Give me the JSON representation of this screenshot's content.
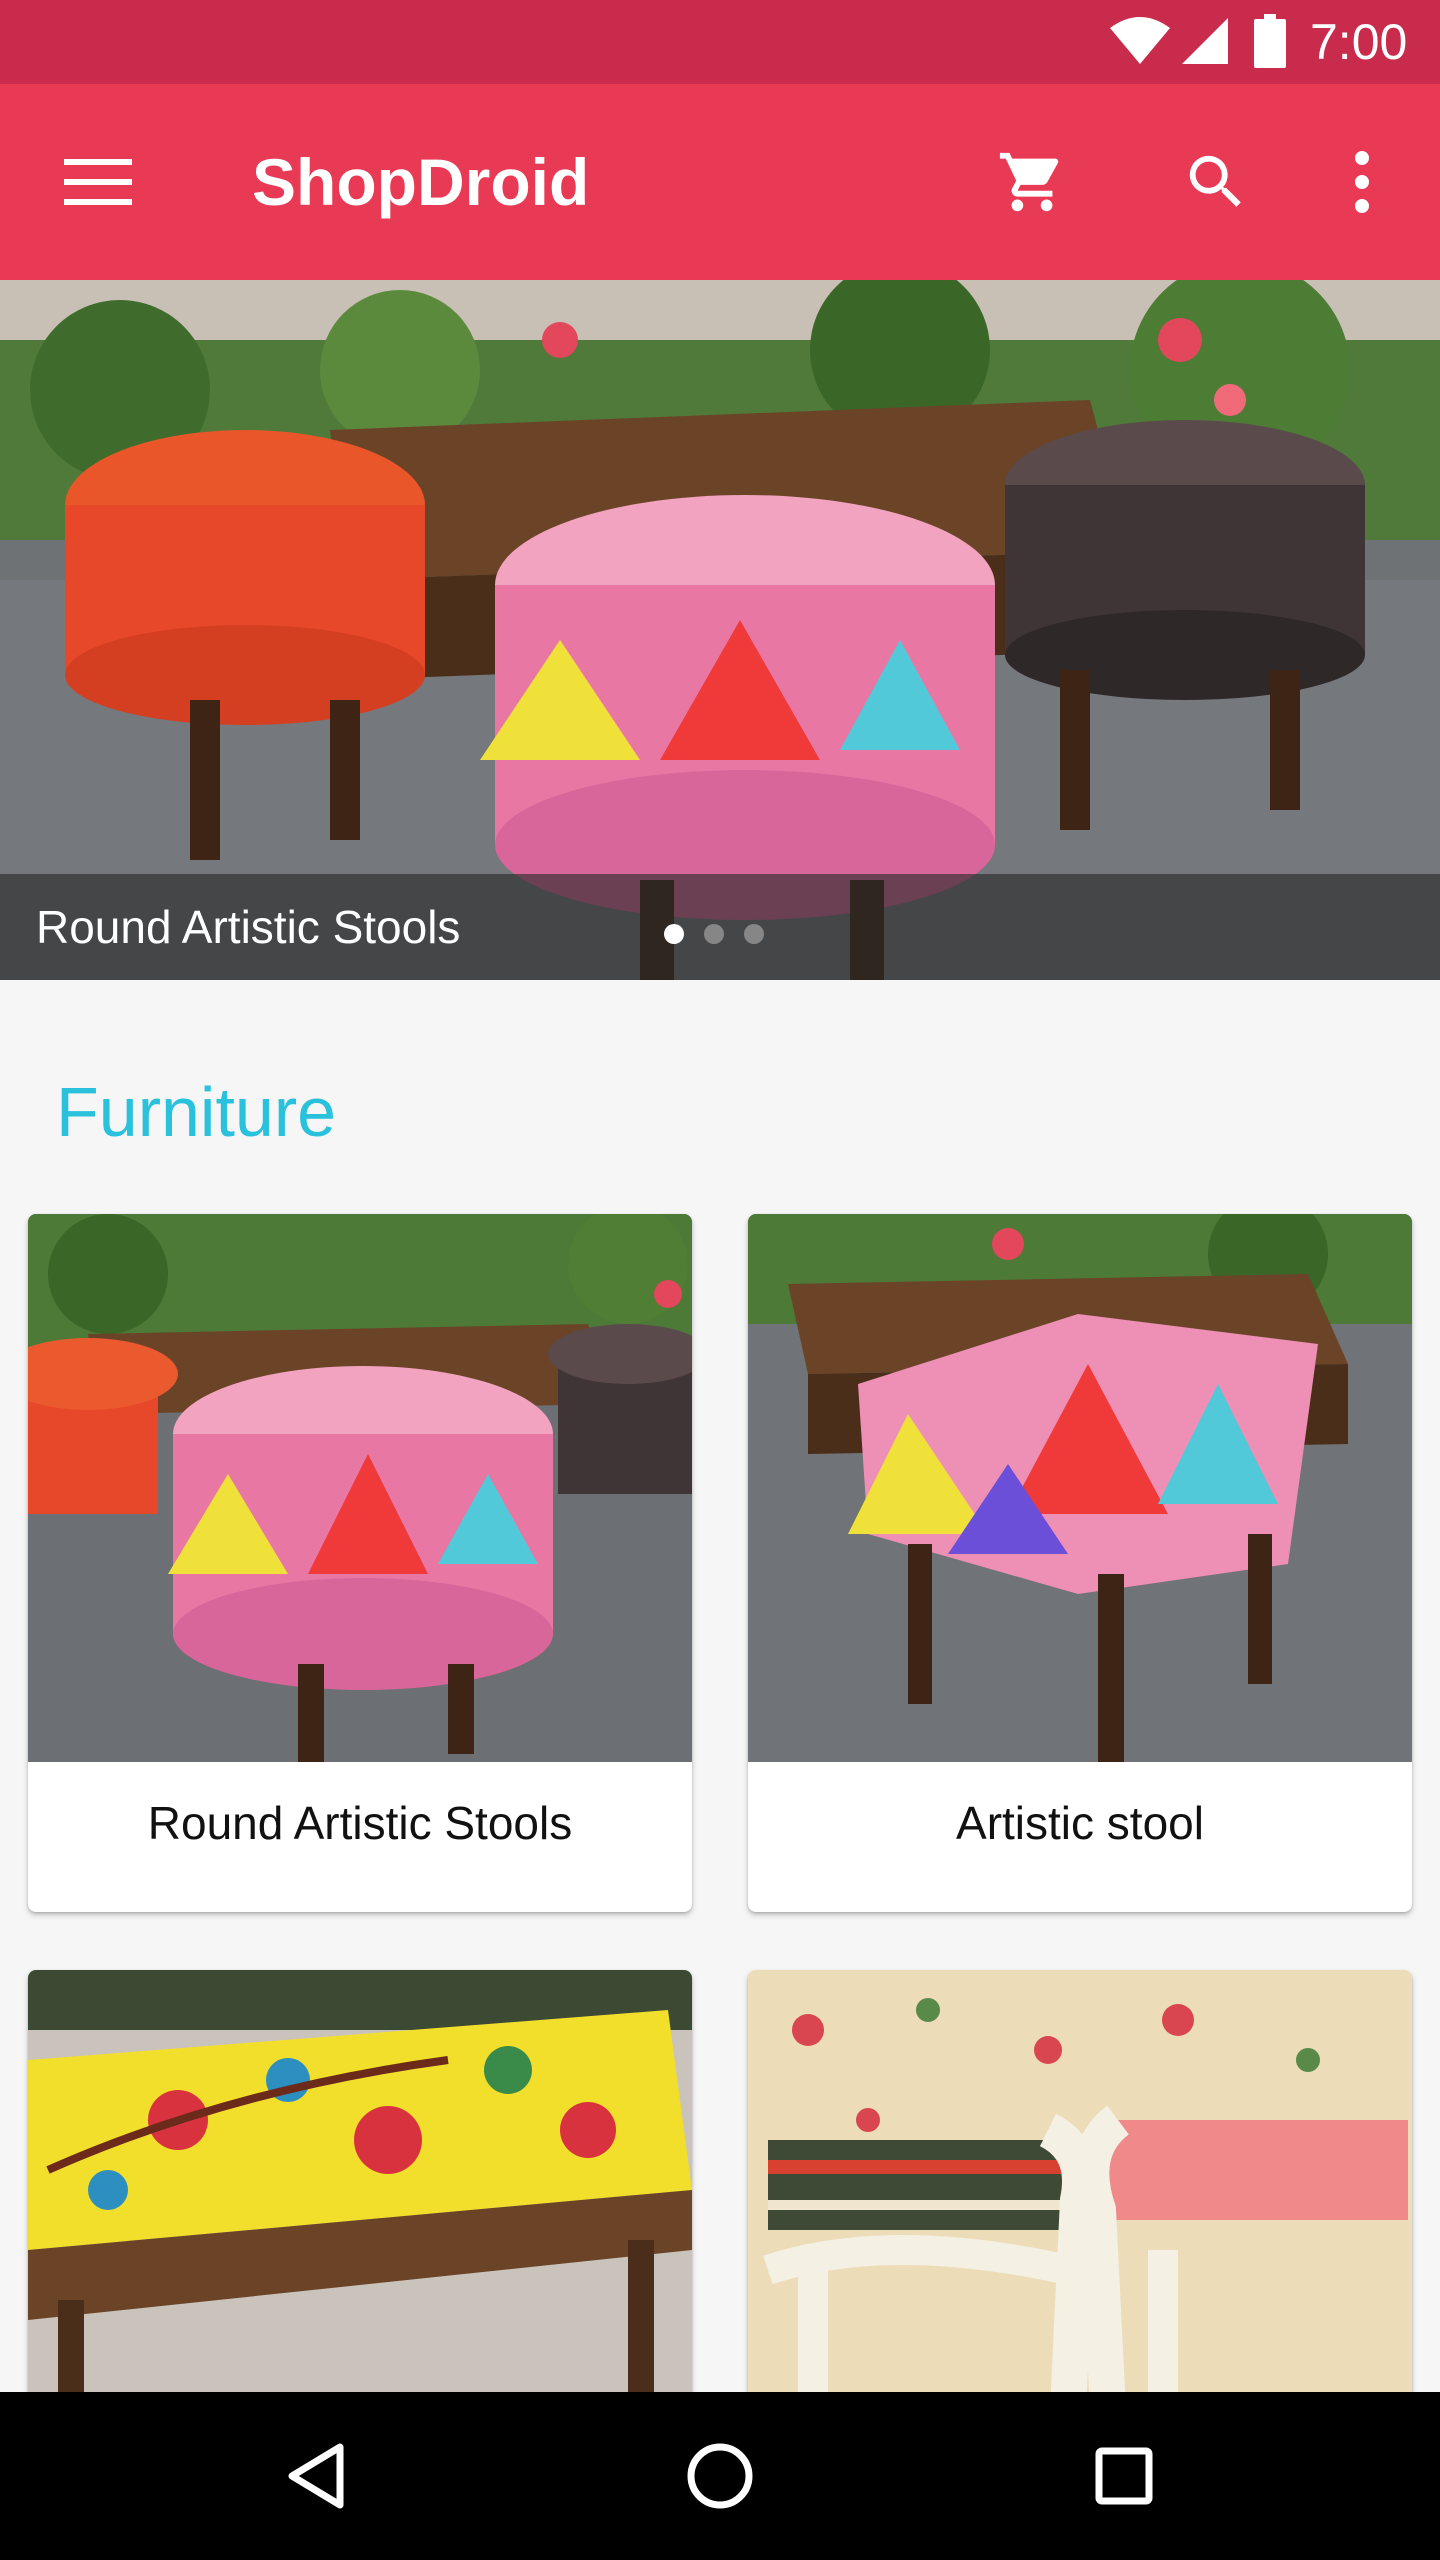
{
  "status_bar": {
    "time": "7:00",
    "icons": [
      "wifi-icon",
      "cell-signal-icon",
      "battery-icon"
    ]
  },
  "app_bar": {
    "title": "ShopDroid",
    "icons": [
      "menu-icon",
      "cart-icon",
      "search-icon",
      "more-vert-icon"
    ]
  },
  "hero": {
    "caption": "Round Artistic Stools",
    "slide_count": 3,
    "active_slide": 1
  },
  "section": {
    "title": "Furniture"
  },
  "products": [
    {
      "label": "Round Artistic Stools"
    },
    {
      "label": "Artistic stool"
    },
    {
      "label": ""
    },
    {
      "label": ""
    }
  ],
  "nav_bar": {
    "icons": [
      "back-icon",
      "home-icon",
      "recents-icon"
    ]
  },
  "colors": {
    "status_bar": "#c92b4c",
    "app_bar": "#e83a55",
    "section_title": "#29c1dc",
    "background": "#f6f6f6"
  }
}
